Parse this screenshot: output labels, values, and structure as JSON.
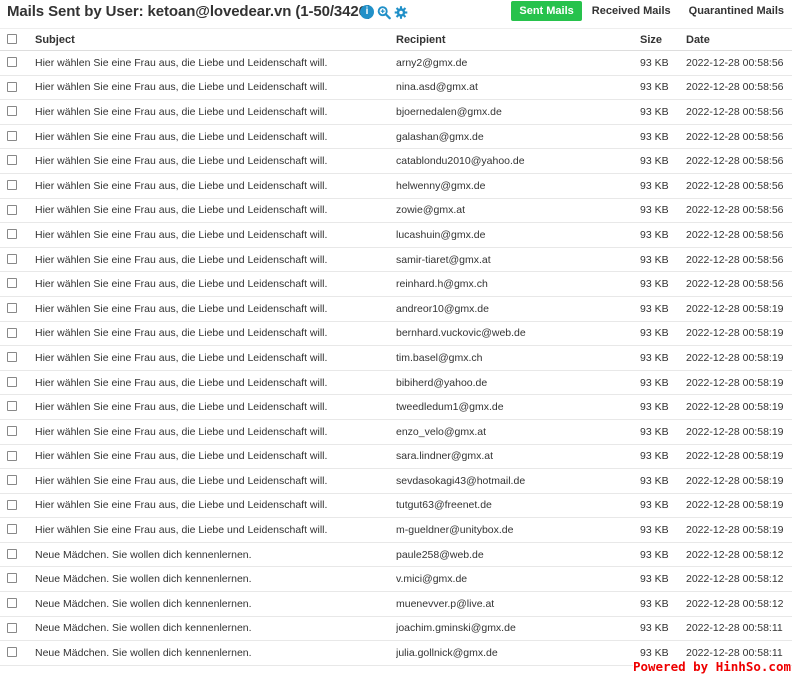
{
  "header": {
    "title": "Mails Sent by User: ketoan@lovedear.vn (1-50/3426)",
    "icons": [
      "info-icon",
      "zoom-search-icon",
      "settings-gear-icon"
    ]
  },
  "tabs": [
    {
      "label": "Sent Mails",
      "active": true
    },
    {
      "label": "Received Mails",
      "active": false
    },
    {
      "label": "Quarantined Mails",
      "active": false
    }
  ],
  "table": {
    "columns": [
      "Subject",
      "Recipient",
      "Size",
      "Date"
    ],
    "rows": [
      {
        "subject": "Hier wählen Sie eine Frau aus, die Liebe und Leidenschaft will.",
        "recipient": "arny2@gmx.de",
        "size": "93 KB",
        "date": "2022-12-28 00:58:56"
      },
      {
        "subject": "Hier wählen Sie eine Frau aus, die Liebe und Leidenschaft will.",
        "recipient": "nina.asd@gmx.at",
        "size": "93 KB",
        "date": "2022-12-28 00:58:56"
      },
      {
        "subject": "Hier wählen Sie eine Frau aus, die Liebe und Leidenschaft will.",
        "recipient": "bjoernedalen@gmx.de",
        "size": "93 KB",
        "date": "2022-12-28 00:58:56"
      },
      {
        "subject": "Hier wählen Sie eine Frau aus, die Liebe und Leidenschaft will.",
        "recipient": "galashan@gmx.de",
        "size": "93 KB",
        "date": "2022-12-28 00:58:56"
      },
      {
        "subject": "Hier wählen Sie eine Frau aus, die Liebe und Leidenschaft will.",
        "recipient": "catablondu2010@yahoo.de",
        "size": "93 KB",
        "date": "2022-12-28 00:58:56"
      },
      {
        "subject": "Hier wählen Sie eine Frau aus, die Liebe und Leidenschaft will.",
        "recipient": "helwenny@gmx.de",
        "size": "93 KB",
        "date": "2022-12-28 00:58:56"
      },
      {
        "subject": "Hier wählen Sie eine Frau aus, die Liebe und Leidenschaft will.",
        "recipient": "zowie@gmx.at",
        "size": "93 KB",
        "date": "2022-12-28 00:58:56"
      },
      {
        "subject": "Hier wählen Sie eine Frau aus, die Liebe und Leidenschaft will.",
        "recipient": "lucashuin@gmx.de",
        "size": "93 KB",
        "date": "2022-12-28 00:58:56"
      },
      {
        "subject": "Hier wählen Sie eine Frau aus, die Liebe und Leidenschaft will.",
        "recipient": "samir-tiaret@gmx.at",
        "size": "93 KB",
        "date": "2022-12-28 00:58:56"
      },
      {
        "subject": "Hier wählen Sie eine Frau aus, die Liebe und Leidenschaft will.",
        "recipient": "reinhard.h@gmx.ch",
        "size": "93 KB",
        "date": "2022-12-28 00:58:56"
      },
      {
        "subject": "Hier wählen Sie eine Frau aus, die Liebe und Leidenschaft will.",
        "recipient": "andreor10@gmx.de",
        "size": "93 KB",
        "date": "2022-12-28 00:58:19"
      },
      {
        "subject": "Hier wählen Sie eine Frau aus, die Liebe und Leidenschaft will.",
        "recipient": "bernhard.vuckovic@web.de",
        "size": "93 KB",
        "date": "2022-12-28 00:58:19"
      },
      {
        "subject": "Hier wählen Sie eine Frau aus, die Liebe und Leidenschaft will.",
        "recipient": "tim.basel@gmx.ch",
        "size": "93 KB",
        "date": "2022-12-28 00:58:19"
      },
      {
        "subject": "Hier wählen Sie eine Frau aus, die Liebe und Leidenschaft will.",
        "recipient": "bibiherd@yahoo.de",
        "size": "93 KB",
        "date": "2022-12-28 00:58:19"
      },
      {
        "subject": "Hier wählen Sie eine Frau aus, die Liebe und Leidenschaft will.",
        "recipient": "tweedledum1@gmx.de",
        "size": "93 KB",
        "date": "2022-12-28 00:58:19"
      },
      {
        "subject": "Hier wählen Sie eine Frau aus, die Liebe und Leidenschaft will.",
        "recipient": "enzo_velo@gmx.at",
        "size": "93 KB",
        "date": "2022-12-28 00:58:19"
      },
      {
        "subject": "Hier wählen Sie eine Frau aus, die Liebe und Leidenschaft will.",
        "recipient": "sara.lindner@gmx.at",
        "size": "93 KB",
        "date": "2022-12-28 00:58:19"
      },
      {
        "subject": "Hier wählen Sie eine Frau aus, die Liebe und Leidenschaft will.",
        "recipient": "sevdasokagi43@hotmail.de",
        "size": "93 KB",
        "date": "2022-12-28 00:58:19"
      },
      {
        "subject": "Hier wählen Sie eine Frau aus, die Liebe und Leidenschaft will.",
        "recipient": "tutgut63@freenet.de",
        "size": "93 KB",
        "date": "2022-12-28 00:58:19"
      },
      {
        "subject": "Hier wählen Sie eine Frau aus, die Liebe und Leidenschaft will.",
        "recipient": "m-gueldner@unitybox.de",
        "size": "93 KB",
        "date": "2022-12-28 00:58:19"
      },
      {
        "subject": "Neue Mädchen. Sie wollen dich kennenlernen.",
        "recipient": "paule258@web.de",
        "size": "93 KB",
        "date": "2022-12-28 00:58:12"
      },
      {
        "subject": "Neue Mädchen. Sie wollen dich kennenlernen.",
        "recipient": "v.mici@gmx.de",
        "size": "93 KB",
        "date": "2022-12-28 00:58:12"
      },
      {
        "subject": "Neue Mädchen. Sie wollen dich kennenlernen.",
        "recipient": "muenevver.p@live.at",
        "size": "93 KB",
        "date": "2022-12-28 00:58:12"
      },
      {
        "subject": "Neue Mädchen. Sie wollen dich kennenlernen.",
        "recipient": "joachim.gminski@gmx.de",
        "size": "93 KB",
        "date": "2022-12-28 00:58:11"
      },
      {
        "subject": "Neue Mädchen. Sie wollen dich kennenlernen.",
        "recipient": "julia.gollnick@gmx.de",
        "size": "93 KB",
        "date": "2022-12-28 00:58:11"
      }
    ]
  },
  "footer": {
    "powered_by": "Powered by HinhSo.com",
    "powered_color": "#e00000"
  },
  "colors": {
    "accent": "#27c24c",
    "icon_blue": "#2190c8"
  }
}
